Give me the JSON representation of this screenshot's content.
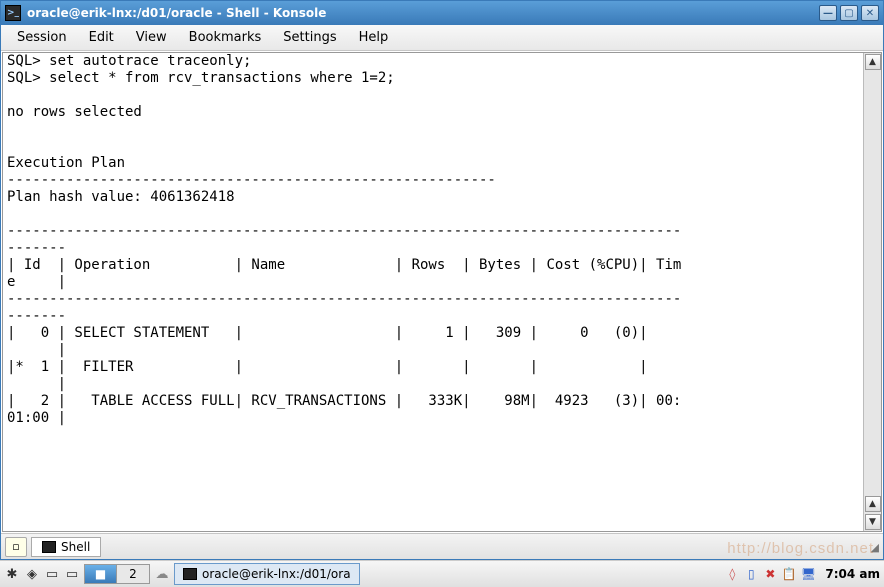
{
  "window": {
    "title": "oracle@erik-lnx:/d01/oracle - Shell - Konsole"
  },
  "menubar": {
    "items": [
      "Session",
      "Edit",
      "View",
      "Bookmarks",
      "Settings",
      "Help"
    ]
  },
  "terminal": {
    "lines": [
      "SQL> set autotrace traceonly;",
      "SQL> select * from rcv_transactions where 1=2;",
      "",
      "no rows selected",
      "",
      "",
      "Execution Plan",
      "----------------------------------------------------------",
      "Plan hash value: 4061362418",
      "",
      "--------------------------------------------------------------------------------",
      "-------",
      "| Id  | Operation          | Name             | Rows  | Bytes | Cost (%CPU)| Tim",
      "e     |",
      "--------------------------------------------------------------------------------",
      "-------",
      "|   0 | SELECT STATEMENT   |                  |     1 |   309 |     0   (0)|    ",
      "      |",
      "|*  1 |  FILTER            |                  |       |       |            |    ",
      "      |",
      "|   2 |   TABLE ACCESS FULL| RCV_TRANSACTIONS |   333K|    98M|  4923   (3)| 00:",
      "01:00 |"
    ]
  },
  "tabs": {
    "active_label": "Shell"
  },
  "taskbar": {
    "desktops": {
      "active": 1,
      "count_extra": "2"
    },
    "task_label": "oracle@erik-lnx:/d01/ora",
    "clock": "7:04 am"
  },
  "watermark": "http://blog.csdn.net"
}
